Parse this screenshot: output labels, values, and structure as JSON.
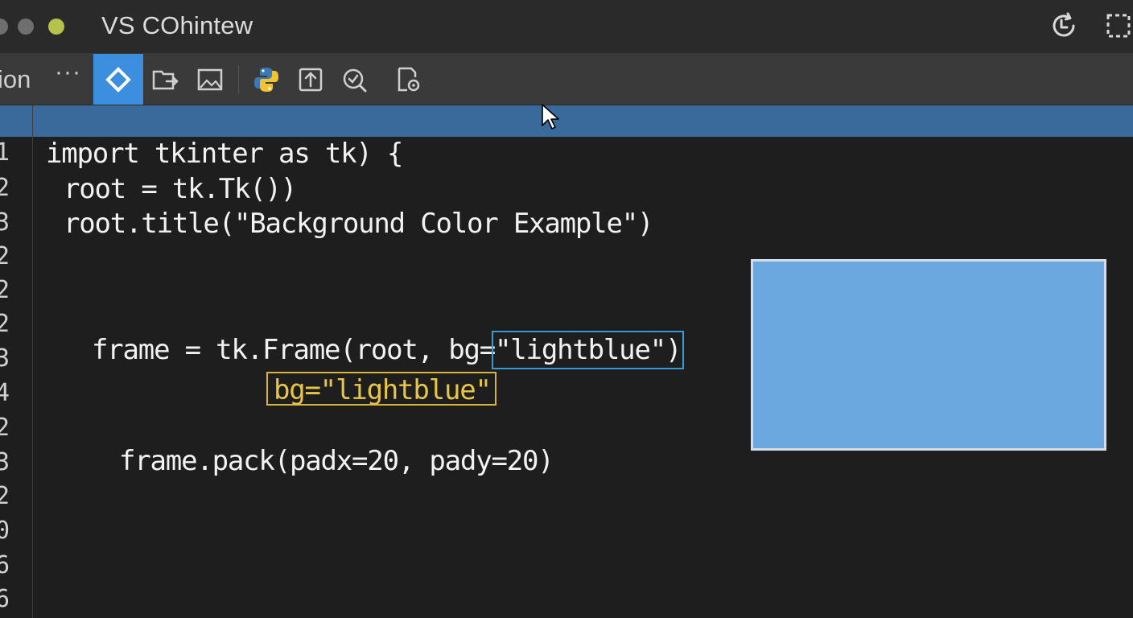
{
  "window": {
    "title": "VS COhintew"
  },
  "toolbar": {
    "left_label": "ion",
    "more_label": "···",
    "tools": [
      {
        "icon": "diamond-icon",
        "active": true
      },
      {
        "icon": "export-folder-icon",
        "active": false
      },
      {
        "icon": "image-frame-icon",
        "active": false
      },
      {
        "icon": "python-icon",
        "active": false
      },
      {
        "icon": "upload-icon",
        "active": false
      },
      {
        "icon": "search-refresh-icon",
        "active": false
      },
      {
        "icon": "document-settings-icon",
        "active": false
      }
    ]
  },
  "titlebar_icons": [
    "history-icon",
    "selection-frame-icon"
  ],
  "editor": {
    "line_numbers": [
      "1",
      "2",
      "3",
      "2",
      "2",
      "2",
      "3",
      "4",
      "2",
      "3",
      "2",
      "0",
      "6",
      "6"
    ],
    "lines": {
      "l1": "import tkinter as tk) {",
      "l2": "root = tk.Tk())",
      "l3": "root.title(\"Background Color Example\")",
      "frame_prefix": "frame = tk.Frame(root, bg=",
      "frame_selected": "\"lightblue\")",
      "hint": "bg=\"lightblue\"",
      "pack": "frame.pack(padx=20, pady=20)"
    }
  },
  "preview": {
    "color": "#6aa8df",
    "border_color": "#d6dde6"
  },
  "colors": {
    "accent": "#3c8fde",
    "highlight_row": "#3a6a9c",
    "hint_yellow": "#e8c547"
  }
}
